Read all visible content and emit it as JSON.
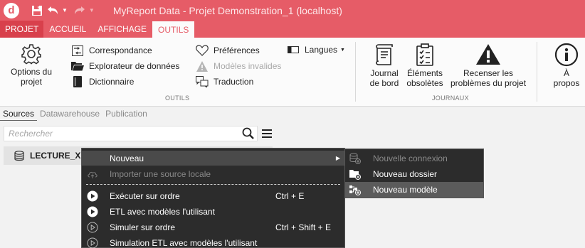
{
  "titlebar": {
    "logo_letter": "d",
    "title": "MyReport Data - Projet Demonstration_1 (localhost)"
  },
  "ribbon_tabs": [
    {
      "label": "PROJET"
    },
    {
      "label": "ACCUEIL"
    },
    {
      "label": "AFFICHAGE"
    },
    {
      "label": "OUTILS"
    }
  ],
  "ribbon": {
    "options_projet_line1": "Options du",
    "options_projet_line2": "projet",
    "correspondance": "Correspondance",
    "explorateur": "Explorateur de données",
    "dictionnaire": "Dictionnaire",
    "preferences": "Préférences",
    "modeles_invalides": "Modèles invalides",
    "traduction": "Traduction",
    "langues": "Langues",
    "group_outils": "OUTILS",
    "journal_line1": "Journal",
    "journal_line2": "de bord",
    "elements_line1": "Éléments",
    "elements_line2": "obsolètes",
    "recenser_line1": "Recenser les",
    "recenser_line2": "problèmes du projet",
    "group_journaux": "JOURNAUX",
    "apropos_line1": "À",
    "apropos_line2": "propos"
  },
  "panel": {
    "tabs": [
      {
        "label": "Sources"
      },
      {
        "label": "Datawarehouse"
      },
      {
        "label": "Publication"
      }
    ],
    "search_placeholder": "Rechercher",
    "tree_item_label": "LECTURE_XM"
  },
  "context_menu": {
    "items": [
      {
        "label": "Nouveau",
        "shortcut": ""
      },
      {
        "label": "Importer une source locale",
        "shortcut": ""
      },
      {
        "label": "Exécuter sur ordre",
        "shortcut": "Ctrl + E"
      },
      {
        "label": "ETL avec modèles l'utilisant",
        "shortcut": ""
      },
      {
        "label": "Simuler sur ordre",
        "shortcut": "Ctrl + Shift + E"
      },
      {
        "label": "Simulation ETL avec modèles l'utilisant",
        "shortcut": ""
      }
    ]
  },
  "submenu": {
    "items": [
      {
        "label": "Nouvelle connexion"
      },
      {
        "label": "Nouveau dossier"
      },
      {
        "label": "Nouveau modèle"
      }
    ]
  },
  "colors": {
    "accent": "#e65c67",
    "menu_bg": "#2c2c2c"
  }
}
